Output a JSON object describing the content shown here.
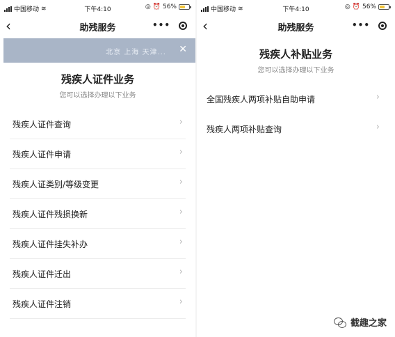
{
  "left": {
    "status": {
      "carrier": "中国移动",
      "time": "下午4:10",
      "battery": "56%"
    },
    "nav": {
      "title": "助残服务"
    },
    "banner": {
      "cities": "北京  上海  天津..."
    },
    "section": {
      "title": "残疾人证件业务",
      "subtitle": "您可以选择办理以下业务"
    },
    "items": [
      {
        "label": "残疾人证件查询"
      },
      {
        "label": "残疾人证件申请"
      },
      {
        "label": "残疾人证类别/等级变更"
      },
      {
        "label": "残疾人证件残损换新"
      },
      {
        "label": "残疾人证件挂失补办"
      },
      {
        "label": "残疾人证件迁出"
      },
      {
        "label": "残疾人证件注销"
      }
    ]
  },
  "right": {
    "status": {
      "carrier": "中国移动",
      "time": "下午4:10",
      "battery": "56%"
    },
    "nav": {
      "title": "助残服务"
    },
    "section": {
      "title": "残疾人补贴业务",
      "subtitle": "您可以选择办理以下业务"
    },
    "items": [
      {
        "label": "全国残疾人两项补贴自助申请"
      },
      {
        "label": "残疾人两项补贴查询"
      }
    ]
  },
  "watermark": {
    "text": "截趣之家"
  },
  "colors": {
    "banner": "#a9b5c7",
    "battery": "#f3c43b",
    "chevron": "#bbbbbb",
    "subtitle": "#888888"
  }
}
